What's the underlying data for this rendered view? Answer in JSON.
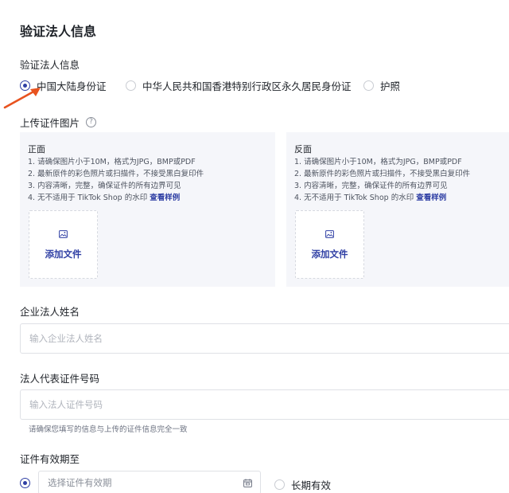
{
  "page": {
    "title": "验证法人信息"
  },
  "verify": {
    "label": "验证法人信息",
    "options": [
      {
        "label": "中国大陆身份证",
        "checked": true
      },
      {
        "label": "中华人民共和国香港特别行政区永久居民身份证",
        "checked": false
      },
      {
        "label": "护照",
        "checked": false
      }
    ]
  },
  "upload": {
    "label": "上传证件图片",
    "help_glyph": "?",
    "front": {
      "title": "正面",
      "reqs": [
        "1. 请确保图片小于10M，格式为JPG，BMP或PDF",
        "2. 最新原件的彩色照片或扫描件，不接受黑白复印件",
        "3. 内容清晰，完整，确保证件的所有边界可见"
      ],
      "req4_prefix": "4. 无不适用于 TikTok Shop 的水印 ",
      "req4_link": "查看样例",
      "add_file": "添加文件"
    },
    "back": {
      "title": "反面",
      "reqs": [
        "1. 请确保图片小于10M，格式为JPG，BMP或PDF",
        "2. 最新原件的彩色照片或扫描件，不接受黑白复印件",
        "3. 内容清晰，完整，确保证件的所有边界可见"
      ],
      "req4_prefix": "4. 无不适用于 TikTok Shop 的水印 ",
      "req4_link": "查看样例",
      "add_file": "添加文件"
    }
  },
  "legal_name": {
    "label": "企业法人姓名",
    "placeholder": "输入企业法人姓名"
  },
  "id_number": {
    "label": "法人代表证件号码",
    "placeholder": "输入法人证件号码",
    "hint": "请确保您填写的信息与上传的证件信息完全一致"
  },
  "validity": {
    "label": "证件有效期至",
    "date_placeholder": "选择证件有效期",
    "date_checked": true,
    "long_term": "长期有效",
    "long_term_checked": false
  },
  "colors": {
    "accent": "#2f3fa4",
    "arrow": "#e8531f",
    "card_bg": "#f5f6fa"
  }
}
